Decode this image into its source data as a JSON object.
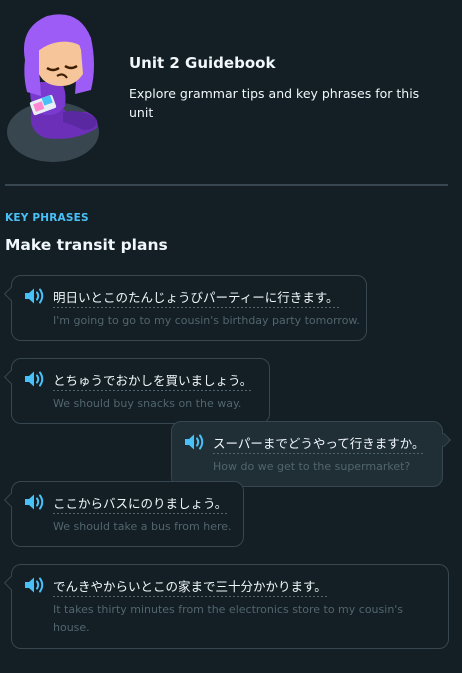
{
  "guidebook": {
    "title": "Unit 2 Guidebook",
    "description": "Explore grammar tips and key phrases for this unit"
  },
  "section": {
    "label": "KEY PHRASES",
    "title": "Make transit plans"
  },
  "phrases": [
    {
      "japanese": "明日いとこのたんじょうびパーティーに行きます。",
      "english": "I'm going to go to my cousin's birthday party tomorrow.",
      "side": "left"
    },
    {
      "japanese": "とちゅうでおかしを買いましょう。",
      "english": "We should buy snacks on the way.",
      "side": "left"
    },
    {
      "japanese": "スーパーまでどうやって行きますか。",
      "english": "How do we get to the supermarket?",
      "side": "right"
    },
    {
      "japanese": "ここからバスにのりましょう。",
      "english": "We should take a bus from here.",
      "side": "left"
    },
    {
      "japanese": "でんきやからいとこの家まで三十分かかります。",
      "english": "It takes thirty minutes from the electronics store to my cousin's house.",
      "side": "left"
    }
  ],
  "icons": {
    "avatar": "character-avatar-icon",
    "speaker": "speaker-icon"
  },
  "colors": {
    "background": "#131f24",
    "accent": "#49c0f8",
    "border": "#37464f",
    "muted_text": "#52656d"
  }
}
